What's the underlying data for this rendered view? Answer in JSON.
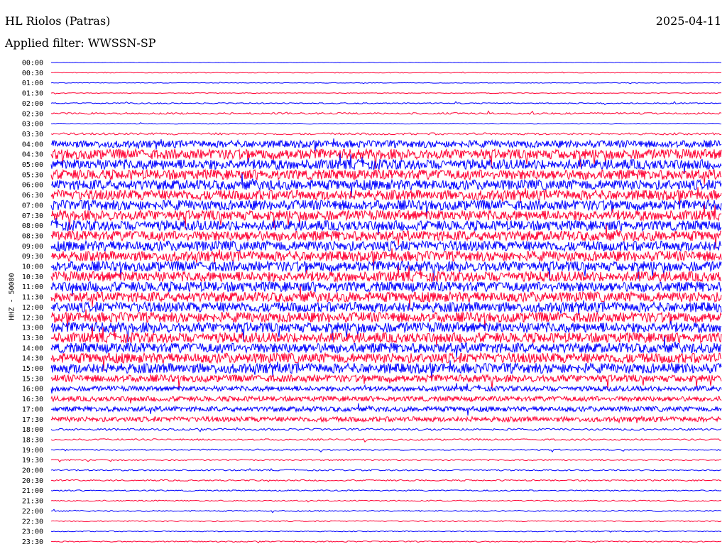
{
  "header": {
    "station": "HL Riolos (Patras)",
    "date": "2025-04-11",
    "filter": "Applied filter: WWSSN-SP"
  },
  "colors": {
    "trace_a": "#0000ff",
    "trace_b": "#ff0033"
  },
  "chart_data": {
    "type": "line",
    "title": "HL Riolos (Patras)",
    "ylabel": "HHZ - 50000",
    "time_labels": [
      "00:00",
      "00:30",
      "01:00",
      "01:30",
      "02:00",
      "02:30",
      "03:00",
      "03:30",
      "04:00",
      "04:30",
      "05:00",
      "05:30",
      "06:00",
      "06:30",
      "07:00",
      "07:30",
      "08:00",
      "08:30",
      "09:00",
      "09:30",
      "10:00",
      "10:30",
      "11:00",
      "11:30",
      "12:00",
      "12:30",
      "13:00",
      "13:30",
      "14:00",
      "14:30",
      "15:00",
      "15:30",
      "16:00",
      "16:30",
      "17:00",
      "17:30",
      "18:00",
      "18:30",
      "19:00",
      "19:30",
      "20:00",
      "20:30",
      "21:00",
      "21:30",
      "22:00",
      "22:30",
      "23:00",
      "23:30"
    ],
    "noise_level": [
      0.3,
      0.5,
      0.4,
      0.5,
      0.8,
      1.2,
      0.6,
      1.5,
      5,
      7,
      7,
      7,
      7,
      7,
      7,
      7,
      7,
      7,
      7,
      7,
      7,
      7,
      7,
      7,
      7,
      7,
      7,
      7,
      7,
      7,
      7,
      5,
      3.5,
      3.5,
      3.5,
      3.5,
      1.5,
      1.2,
      1,
      1,
      1,
      1,
      0.9,
      0.9,
      0.9,
      0.8,
      0.7,
      0.8
    ]
  }
}
